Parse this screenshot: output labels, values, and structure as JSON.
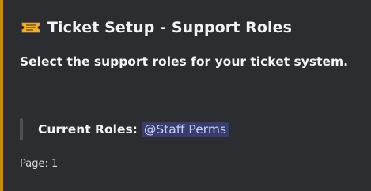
{
  "embed": {
    "accent_color": "#c28d0a",
    "icon": "ticket-icon",
    "title": "Ticket Setup - Support Roles",
    "description": "Select the support roles for your ticket system.",
    "current_roles": {
      "label": "Current Roles:",
      "roles": [
        "@Staff Perms"
      ]
    },
    "footer": "Page: 1"
  }
}
